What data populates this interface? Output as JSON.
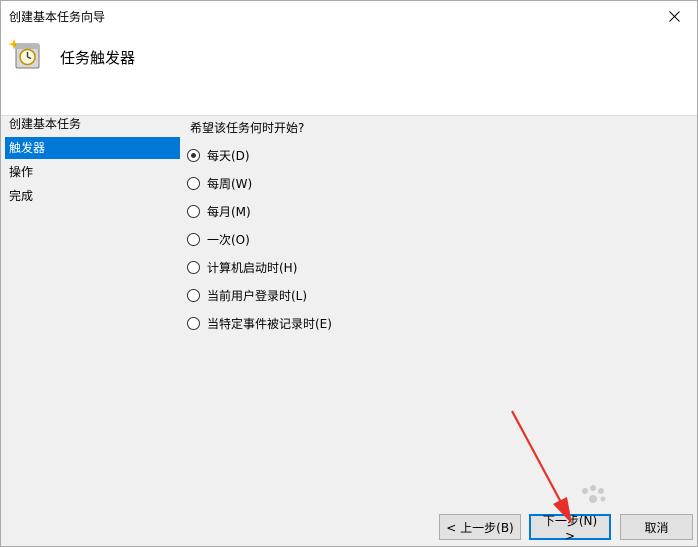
{
  "window": {
    "title": "创建基本任务向导"
  },
  "header": {
    "title": "任务触发器"
  },
  "sidebar": {
    "items": [
      {
        "label": "创建基本任务",
        "active": false
      },
      {
        "label": "触发器",
        "active": true
      },
      {
        "label": "操作",
        "active": false
      },
      {
        "label": "完成",
        "active": false
      }
    ]
  },
  "content": {
    "question": "希望该任务何时开始?",
    "options": [
      {
        "label": "每天(D)",
        "checked": true
      },
      {
        "label": "每周(W)",
        "checked": false
      },
      {
        "label": "每月(M)",
        "checked": false
      },
      {
        "label": "一次(O)",
        "checked": false
      },
      {
        "label": "计算机启动时(H)",
        "checked": false
      },
      {
        "label": "当前用户登录时(L)",
        "checked": false
      },
      {
        "label": "当特定事件被记录时(E)",
        "checked": false
      }
    ]
  },
  "buttons": {
    "back": "< 上一步(B)",
    "next": "下一步(N) >",
    "cancel": "取消"
  },
  "colors": {
    "accent": "#0078d7",
    "arrow": "#e8302a"
  },
  "icons": {
    "close": "close-icon",
    "task": "task-clock-icon"
  }
}
